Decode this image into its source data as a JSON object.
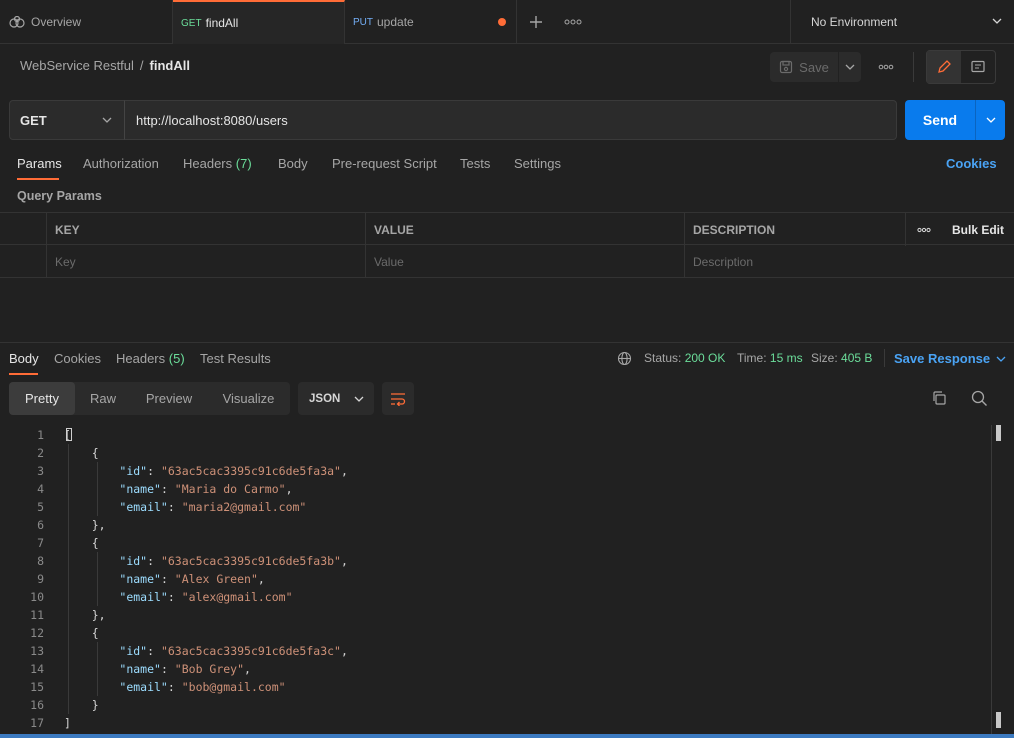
{
  "tabs": [
    {
      "label": "Overview",
      "icon": "overview-icon"
    },
    {
      "method": "GET",
      "label": "findAll",
      "active": true
    },
    {
      "method": "PUT",
      "label": "update",
      "unsaved": true
    }
  ],
  "environment": "No Environment",
  "breadcrumb": {
    "parent": "WebService Restful",
    "current": "findAll"
  },
  "toolbar": {
    "save_label": "Save"
  },
  "request": {
    "method": "GET",
    "url": "http://localhost:8080/users",
    "send_label": "Send"
  },
  "request_tabs": {
    "params": "Params",
    "authorization": "Authorization",
    "headers": "Headers",
    "headers_count": "(7)",
    "body": "Body",
    "prerequest": "Pre-request Script",
    "tests": "Tests",
    "settings": "Settings",
    "cookies": "Cookies"
  },
  "query_params": {
    "title": "Query Params",
    "columns": {
      "key": "KEY",
      "value": "VALUE",
      "description": "DESCRIPTION"
    },
    "bulk_edit": "Bulk Edit",
    "placeholders": {
      "key": "Key",
      "value": "Value",
      "description": "Description"
    }
  },
  "response": {
    "tabs": {
      "body": "Body",
      "cookies": "Cookies",
      "headers": "Headers",
      "headers_count": "(5)",
      "test_results": "Test Results"
    },
    "status_label": "Status:",
    "status_value": "200 OK",
    "time_label": "Time:",
    "time_value": "15 ms",
    "size_label": "Size:",
    "size_value": "405 B",
    "save_response": "Save Response",
    "views": [
      "Pretty",
      "Raw",
      "Preview",
      "Visualize"
    ],
    "format": "JSON"
  },
  "code_lines": [
    {
      "n": "1",
      "t": "["
    },
    {
      "n": "2",
      "t": "    {"
    },
    {
      "n": "3",
      "indent": "        ",
      "key": "\"id\"",
      "val": "\"63ac5cac3395c91c6de5fa3a\"",
      "end": ","
    },
    {
      "n": "4",
      "indent": "        ",
      "key": "\"name\"",
      "val": "\"Maria do Carmo\"",
      "end": ","
    },
    {
      "n": "5",
      "indent": "        ",
      "key": "\"email\"",
      "val": "\"maria2@gmail.com\"",
      "end": ""
    },
    {
      "n": "6",
      "t": "    },"
    },
    {
      "n": "7",
      "t": "    {"
    },
    {
      "n": "8",
      "indent": "        ",
      "key": "\"id\"",
      "val": "\"63ac5cac3395c91c6de5fa3b\"",
      "end": ","
    },
    {
      "n": "9",
      "indent": "        ",
      "key": "\"name\"",
      "val": "\"Alex Green\"",
      "end": ","
    },
    {
      "n": "10",
      "indent": "        ",
      "key": "\"email\"",
      "val": "\"alex@gmail.com\"",
      "end": ""
    },
    {
      "n": "11",
      "t": "    },"
    },
    {
      "n": "12",
      "t": "    {"
    },
    {
      "n": "13",
      "indent": "        ",
      "key": "\"id\"",
      "val": "\"63ac5cac3395c91c6de5fa3c\"",
      "end": ","
    },
    {
      "n": "14",
      "indent": "        ",
      "key": "\"name\"",
      "val": "\"Bob Grey\"",
      "end": ","
    },
    {
      "n": "15",
      "indent": "        ",
      "key": "\"email\"",
      "val": "\"bob@gmail.com\"",
      "end": ""
    },
    {
      "n": "16",
      "t": "    }"
    },
    {
      "n": "17",
      "t": "]"
    }
  ],
  "colors": {
    "accent": "#ff6c37",
    "primary": "#097bed",
    "link": "#4aa3f4",
    "success": "#6bdd9a"
  }
}
